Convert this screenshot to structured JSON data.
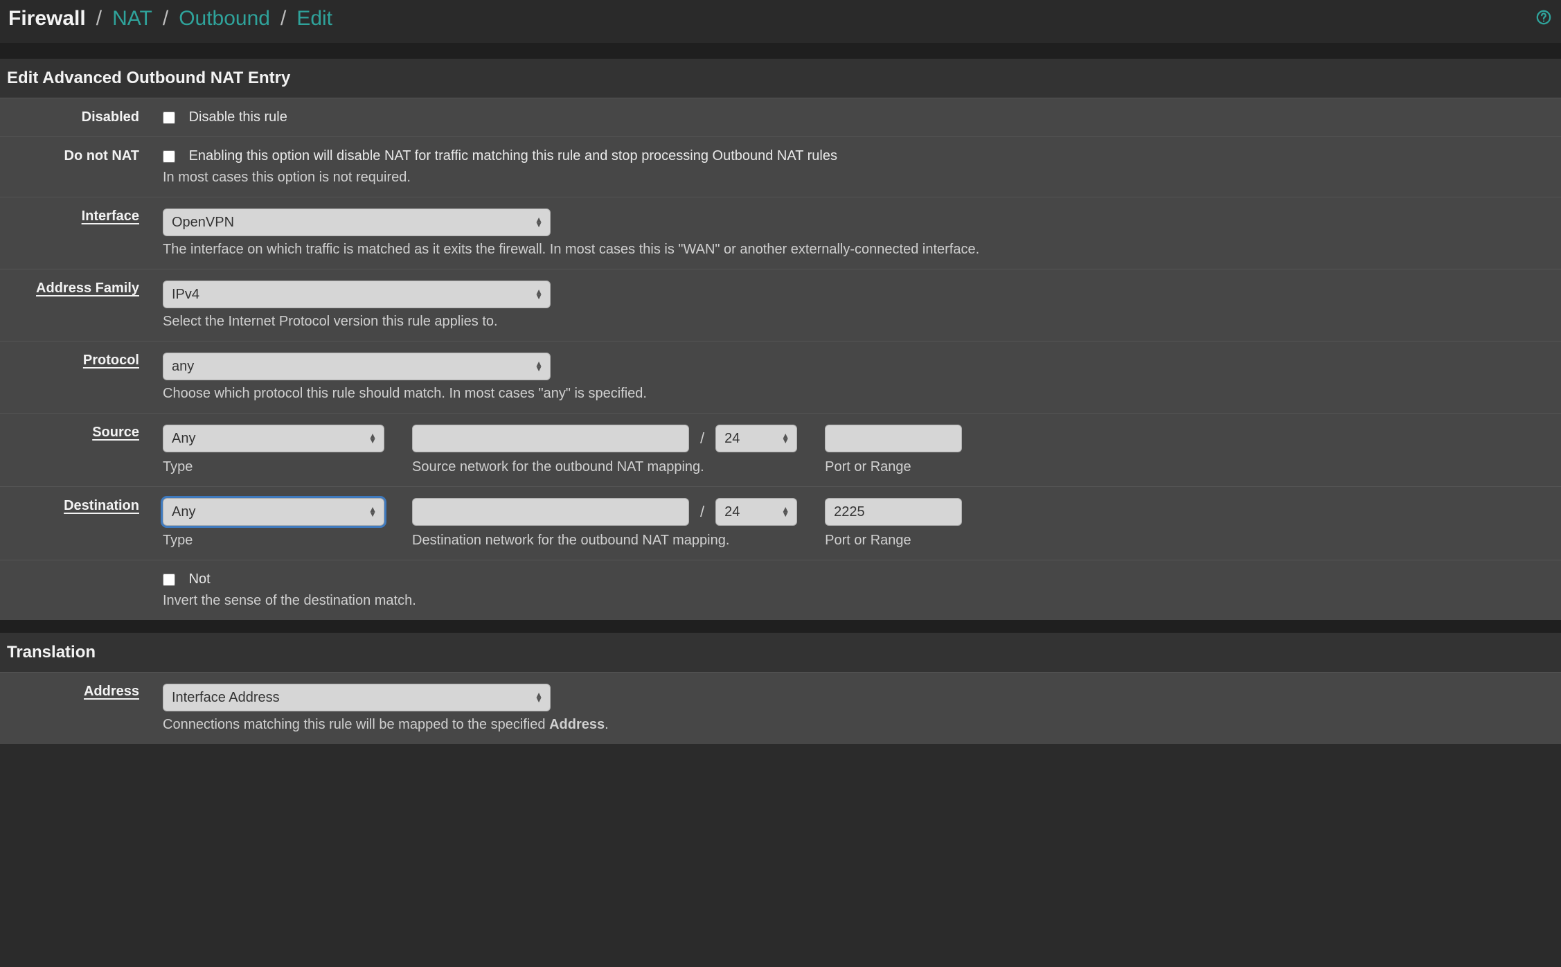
{
  "breadcrumb": {
    "root": "Firewall",
    "a": "NAT",
    "b": "Outbound",
    "c": "Edit"
  },
  "panel1": {
    "title": "Edit Advanced Outbound NAT Entry"
  },
  "disabled": {
    "label": "Disabled",
    "checkbox_label": "Disable this rule"
  },
  "nonat": {
    "label": "Do not NAT",
    "checkbox_label": "Enabling this option will disable NAT for traffic matching this rule and stop processing Outbound NAT rules",
    "hint": "In most cases this option is not required."
  },
  "interface": {
    "label": "Interface",
    "value": "OpenVPN",
    "hint": "The interface on which traffic is matched as it exits the firewall. In most cases this is \"WAN\" or another externally-connected interface."
  },
  "afamily": {
    "label": "Address Family",
    "value": "IPv4",
    "hint": "Select the Internet Protocol version this rule applies to."
  },
  "protocol": {
    "label": "Protocol",
    "value": "any",
    "hint": "Choose which protocol this rule should match. In most cases \"any\" is specified."
  },
  "source": {
    "label": "Source",
    "type": "Any",
    "type_hint": "Type",
    "network": "",
    "cidr": "24",
    "network_hint": "Source network for the outbound NAT mapping.",
    "port": "",
    "port_hint": "Port or Range"
  },
  "destination": {
    "label": "Destination",
    "type": "Any",
    "type_hint": "Type",
    "network": "",
    "cidr": "24",
    "network_hint": "Destination network for the outbound NAT mapping.",
    "port": "2225",
    "port_hint": "Port or Range"
  },
  "not": {
    "checkbox_label": "Not",
    "hint": "Invert the sense of the destination match."
  },
  "panel2": {
    "title": "Translation"
  },
  "translation": {
    "label": "Address",
    "value": "Interface Address",
    "hint_prefix": "Connections matching this rule will be mapped to the specified ",
    "hint_bold": "Address",
    "hint_suffix": "."
  }
}
